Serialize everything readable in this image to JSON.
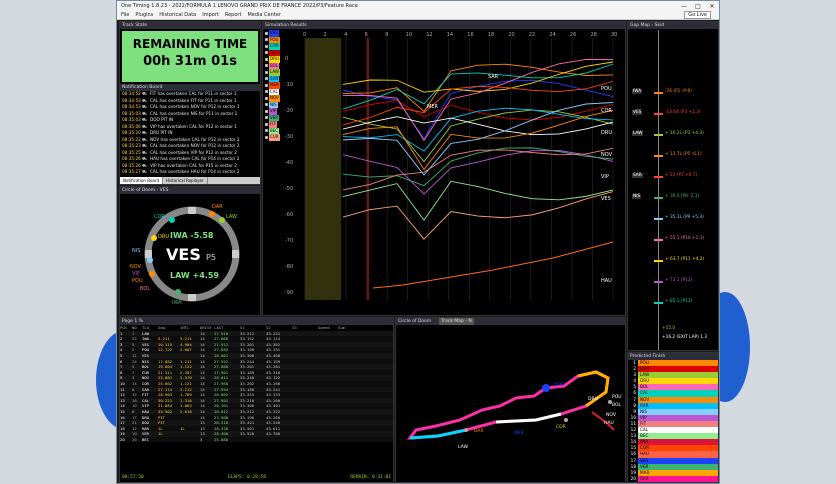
{
  "window": {
    "title": "One Timing 1.8.23 - 2022/FORMULA 1 LENOVO GRAND PRIX DE FRANCE 2022/P3/Feature Race",
    "controls": [
      "—",
      "□",
      "✕"
    ]
  },
  "menu": [
    "File",
    "Plugins",
    "Historical Data",
    "Import",
    "Report",
    "Media Center"
  ],
  "go_live": "Go Live",
  "track_state": {
    "header": "Track State",
    "line1": "REMAINING TIME",
    "line2": "00h 31m 01s",
    "color": "#7fe07f"
  },
  "notifications": {
    "header": "Notification Board",
    "items": [
      {
        "time": "08:34:52",
        "text": "FIT has overtaken CAL for P11 in sector 1"
      },
      {
        "time": "08:34:53",
        "text": "CAL has overtaken FIT for P11 in sector 1"
      },
      {
        "time": "08:34:53",
        "text": "CAL has overtaken NOV for P12 in sector 1"
      },
      {
        "time": "08:35:03",
        "text": "CAL has overtaken NIS for P11 in sector 1"
      },
      {
        "time": "08:35:03",
        "text": "DOO PIT IN"
      },
      {
        "time": "08:35:06",
        "text": "VIP has overtaken CAL for P12 in sector 1"
      },
      {
        "time": "08:35:20",
        "text": "DRU PIT IN"
      },
      {
        "time": "08:35:22",
        "text": "NOV has overtaken CAL for P12 in sector 2"
      },
      {
        "time": "08:35:23",
        "text": "CAL has overtaken NOV for P12 in sector 2"
      },
      {
        "time": "08:35:25",
        "text": "CAL has overtaken VIP for P12 in sector 2"
      },
      {
        "time": "08:35:26",
        "text": "HAU has overtaken CAL for P14 in sector 2"
      },
      {
        "time": "08:35:26",
        "text": "VIP has overtaken CAL for P15 in sector 2"
      },
      {
        "time": "08:35:27",
        "text": "CAL has overtaken HAU for P14 in sector 2"
      }
    ],
    "tabs": [
      "Notification Board",
      "Historical Replayer"
    ]
  },
  "circle_of_doom": {
    "header": "Circle of Doom - VES",
    "driver": "VES",
    "position": "P5",
    "ahead": "IWA -5.58",
    "behind": "LAW +4.59",
    "names": [
      "DAR",
      "COR",
      "LAW",
      "DRU",
      "NIS",
      "NOV",
      "VIP",
      "POU",
      "BOL",
      "IWA"
    ]
  },
  "simulation": {
    "header": "Simulation Results",
    "x_ticks": [
      "0",
      "2",
      "4",
      "6",
      "8",
      "10",
      "12",
      "14",
      "16",
      "18",
      "20",
      "22",
      "24",
      "26",
      "28",
      "30"
    ],
    "y_ticks": [
      "0",
      "-10",
      "-20",
      "-30",
      "-40",
      "-50",
      "-60",
      "-70",
      "-80",
      "-90"
    ],
    "right_labels": [
      "POU",
      "COR",
      "DRU",
      "NOV",
      "VIP",
      "VES",
      "HAU"
    ],
    "mid_labels": [
      "SAR",
      "MER"
    ]
  },
  "legend": [
    {
      "code": "VES",
      "color": "#1e41ff"
    },
    {
      "code": "POU",
      "color": "#ff8700"
    },
    {
      "code": "COR",
      "color": "#00d2be"
    },
    {
      "code": "DOO",
      "color": "#dc0000"
    },
    {
      "code": "DRU",
      "color": "#ffd700"
    },
    {
      "code": "BOL",
      "color": "#ff69b4"
    },
    {
      "code": "LAW",
      "color": "#9acd32"
    },
    {
      "code": "SAR",
      "color": "#00bfff"
    },
    {
      "code": "MER",
      "color": "#ff4500"
    },
    {
      "code": "CAL",
      "color": "#ffffff"
    },
    {
      "code": "NOV",
      "color": "#ff8c00"
    },
    {
      "code": "NIS",
      "color": "#87cefa"
    },
    {
      "code": "VIP",
      "color": "#ba55d3"
    },
    {
      "code": "VER",
      "color": "#3cb371"
    },
    {
      "code": "FIT",
      "color": "#f08080"
    },
    {
      "code": "BEC",
      "color": "#90ee90"
    },
    {
      "code": "CUR",
      "color": "#ffa07a"
    }
  ],
  "gap_map": {
    "header": "Gap Map - Skid",
    "items": [
      {
        "label": "IWA",
        "gap": "-26 (P1 -9.8)"
      },
      {
        "label": "VES",
        "gap": "-14.64 (P2 +2.3)"
      },
      {
        "label": "LAW",
        "gap": "+ 10.2L (P3 +4.3)"
      },
      {
        "label": "",
        "gap": "+ 13.7L (P5 -6.1)"
      },
      {
        "label": "SAR",
        "gap": "+ 22 (P7 +0.7)"
      },
      {
        "label": "NIS",
        "gap": "+ 30.0 (P8 -2.3)"
      },
      {
        "label": "",
        "gap": "+ 35.1L (P9 +5.3)"
      },
      {
        "label": "",
        "gap": "+ 55.1 (P10 +1.1)"
      },
      {
        "label": "",
        "gap": "+ 63.7 (P11 +4.2)"
      },
      {
        "label": "",
        "gap": "+ 73.1 (P12)"
      },
      {
        "label": "",
        "gap": "+ 85.1 (P13)"
      }
    ],
    "bottom": [
      "+15.0",
      "+16.2 (EXIT LAP) 1.3"
    ]
  },
  "predicted": {
    "header": "Predicted Finish",
    "rows": [
      {
        "p": "1",
        "code": "POU",
        "color": "#ff8700"
      },
      {
        "p": "2",
        "code": "DOO",
        "color": "#dc0000"
      },
      {
        "p": "3",
        "code": "LAW",
        "color": "#9acd32"
      },
      {
        "p": "4",
        "code": "DRU",
        "color": "#ffd700"
      },
      {
        "p": "5",
        "code": "BOL",
        "color": "#ff69b4"
      },
      {
        "p": "6",
        "code": "CAL",
        "color": "#00d2be"
      },
      {
        "p": "7",
        "code": "NOV",
        "color": "#ff8c00"
      },
      {
        "p": "8",
        "code": "SAR",
        "color": "#00bfff"
      },
      {
        "p": "9",
        "code": "NIS",
        "color": "#87cefa"
      },
      {
        "p": "10",
        "code": "VIP",
        "color": "#ba55d3"
      },
      {
        "p": "11",
        "code": "FIT",
        "color": "#f08080"
      },
      {
        "p": "12",
        "code": "CAL",
        "color": "#ffffff"
      },
      {
        "p": "13",
        "code": "BEC",
        "color": "#90ee90"
      },
      {
        "p": "14",
        "code": "IWA",
        "color": "#dc143c"
      },
      {
        "p": "15",
        "code": "COR",
        "color": "#ff4500"
      },
      {
        "p": "16",
        "code": "HAU",
        "color": "#ff6347"
      },
      {
        "p": "17",
        "code": "VES",
        "color": "#1e41ff"
      },
      {
        "p": "18",
        "code": "VER",
        "color": "#3cb371"
      },
      {
        "p": "19",
        "code": "MAR",
        "color": "#ffa500"
      },
      {
        "p": "20",
        "code": "SAR",
        "color": "#ff1493"
      },
      {
        "p": "21",
        "code": "ARM",
        "color": "#ffff00"
      },
      {
        "p": "22",
        "code": "DUR",
        "color": "#00ff7f"
      }
    ]
  },
  "timing": {
    "header": "Page 1 %",
    "columns": [
      "POS",
      "NO",
      "TLA",
      "Gap",
      "INTL",
      "DRIVE",
      "LAST",
      "S1",
      "S2",
      "S3",
      "Speed",
      "Sum"
    ],
    "rows": [
      [
        "1",
        "1",
        "LAW",
        "",
        "",
        "14",
        "27.910",
        "33.212",
        "43.221"
      ],
      [
        "2",
        "22",
        "IWA",
        "5.211",
        "5.211",
        "14",
        "27.860",
        "33.152",
        "43.114"
      ],
      [
        "3",
        "9",
        "VES",
        "10.115",
        "4.904",
        "14",
        "27.912",
        "33.201",
        "43.302"
      ],
      [
        "4",
        "2",
        "POU",
        "12.722",
        "2.607",
        "14",
        "27.855",
        "33.190",
        "43.251"
      ],
      [
        "5",
        "11",
        "VES",
        "",
        "",
        "14",
        "28.001",
        "33.300",
        "43.400"
      ],
      [
        "6",
        "24",
        "NIS",
        "17.882",
        "1.211",
        "14",
        "27.922",
        "33.244",
        "43.199"
      ],
      [
        "7",
        "5",
        "BOL",
        "19.004",
        "1.122",
        "14",
        "27.880",
        "33.201",
        "43.281"
      ],
      [
        "8",
        "7",
        "CUR",
        "21.311",
        "2.307",
        "14",
        "27.901",
        "33.189",
        "43.310"
      ],
      [
        "9",
        "3",
        "NOV",
        "23.881",
        "2.570",
        "14",
        "28.011",
        "33.240",
        "43.122"
      ],
      [
        "10",
        "14",
        "COR",
        "25.002",
        "1.121",
        "14",
        "27.960",
        "33.202",
        "43.266"
      ],
      [
        "11",
        "8",
        "SAR",
        "27.114",
        "2.112",
        "14",
        "27.944",
        "33.180",
        "43.241"
      ],
      [
        "12",
        "15",
        "FIT",
        "28.903",
        "1.789",
        "14",
        "28.002",
        "33.255",
        "43.333"
      ],
      [
        "13",
        "16",
        "CAL",
        "30.221",
        "1.318",
        "14",
        "27.992",
        "33.210",
        "43.200"
      ],
      [
        "14",
        "10",
        "VIP",
        "31.884",
        "1.663",
        "14",
        "28.101",
        "33.300",
        "43.401"
      ],
      [
        "15",
        "6",
        "HAU",
        "33.902",
        "2.018",
        "14",
        "28.012",
        "33.212",
        "43.322"
      ],
      [
        "16",
        "17",
        "DRU",
        "PIT",
        "",
        "14",
        "27.988",
        "33.190",
        "43.260"
      ],
      [
        "17",
        "21",
        "DOO",
        "PIT",
        "",
        "13",
        "28.210",
        "33.421",
        "43.540"
      ],
      [
        "18",
        "12",
        "MAR",
        "1L",
        "1L",
        "13",
        "28.330",
        "33.501",
        "43.611"
      ],
      [
        "19",
        "19",
        "VER",
        "1L",
        "",
        "13",
        "28.400",
        "33.520",
        "43.700"
      ],
      [
        "20",
        "20",
        "BEC",
        "",
        "",
        "3",
        "25.888",
        "",
        ""
      ]
    ],
    "footer": [
      "00:57:30",
      "ELAPS: 0:28:58",
      "REMAIN: 0:31:01"
    ]
  },
  "track_map": {
    "tabs": [
      "Circle of Doom",
      "Track Map - N"
    ],
    "labels": [
      "LAW",
      "DAR",
      "MER",
      "DOO",
      "COR",
      "DRU",
      "POU",
      "BOL",
      "NOV",
      "HAU"
    ]
  }
}
